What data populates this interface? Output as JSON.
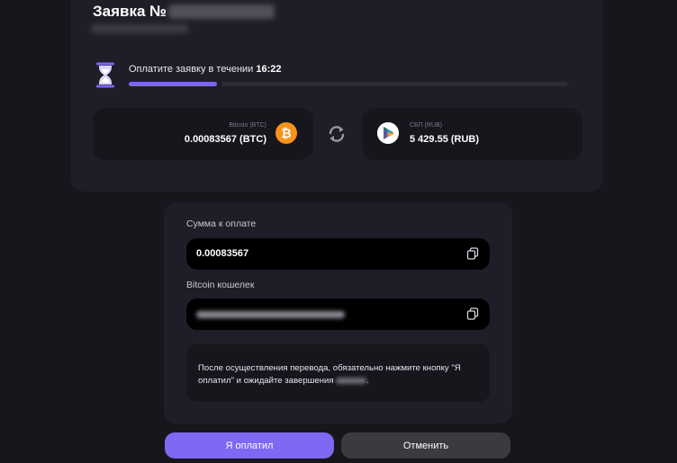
{
  "header": {
    "title": "Заявка №"
  },
  "timer": {
    "prefix": "Оплатите заявку в течении",
    "time": "16:22",
    "progress_percent": 20
  },
  "exchange": {
    "from": {
      "currency_label": "Bitcoin (BTC)",
      "amount": "0.00083567 (BTC)",
      "icon": "bitcoin-icon",
      "icon_glyph": "₿",
      "color": "#f7931a"
    },
    "to": {
      "currency_label": "СБП (RUB)",
      "amount": "5 429.55 (RUB)",
      "icon": "sbp-icon"
    }
  },
  "payment": {
    "amount_label": "Сумма к оплате",
    "amount_value": "0.00083567",
    "wallet_label": "Bitcoin кошелек",
    "notice_text": "После осуществления перевода, обязательно нажмите кнопку \"Я оплатил\" и ожидайте завершения",
    "notice_end": "."
  },
  "actions": {
    "paid_label": "Я оплатил",
    "cancel_label": "Отменить"
  },
  "colors": {
    "accent": "#7d69f2",
    "background": "#17161d",
    "card": "#1f1e28"
  }
}
